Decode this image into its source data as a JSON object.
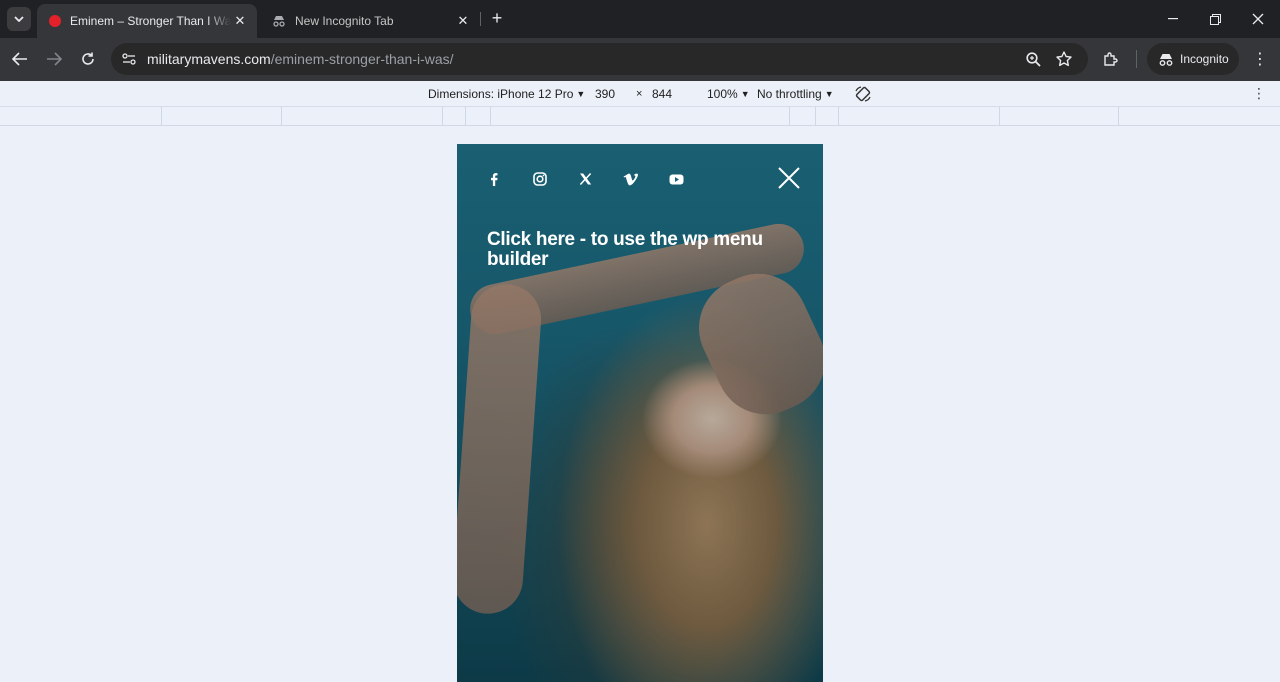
{
  "browser": {
    "tabs": [
      {
        "title": "Eminem – Stronger Than I Was",
        "active": true,
        "favicon": "red-record-favicon"
      },
      {
        "title": "New Incognito Tab",
        "active": false,
        "favicon": "incognito-icon"
      }
    ],
    "address": {
      "host": "militarymavens.com",
      "path": "/eminem-stronger-than-i-was/"
    },
    "profile_label": "Incognito"
  },
  "devtools": {
    "dimensions_label": "Dimensions: iPhone 12 Pro",
    "width": "390",
    "times": "×",
    "height": "844",
    "zoom": "100%",
    "throttling": "No throttling"
  },
  "page": {
    "social_icons": [
      "facebook-icon",
      "instagram-icon",
      "x-twitter-icon",
      "vimeo-icon",
      "youtube-icon"
    ],
    "menu_link": "Click here - to use the wp menu builder",
    "colors": {
      "background": "#1a6378",
      "text": "#ffffff"
    }
  }
}
